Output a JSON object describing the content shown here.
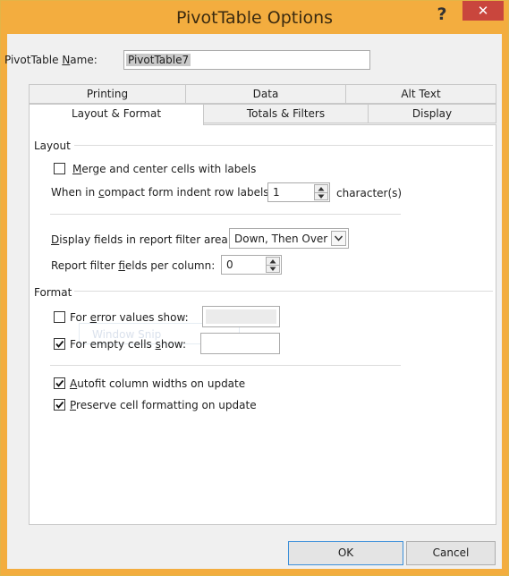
{
  "window": {
    "title": "PivotTable Options",
    "help_glyph": "?",
    "close_glyph": "✕"
  },
  "name_field": {
    "label_pre": "PivotTable ",
    "label_mnemonic": "N",
    "label_post": "ame:",
    "value": "PivotTable7"
  },
  "tabs": {
    "back_row": [
      "Printing",
      "Data",
      "Alt Text"
    ],
    "front_row": [
      "Layout & Format",
      "Totals & Filters",
      "Display"
    ],
    "active": "Layout & Format"
  },
  "layout_section": {
    "heading": "Layout",
    "merge_center": {
      "mnemonic": "M",
      "label_rest": "erge and center cells with labels",
      "checked": false
    },
    "indent": {
      "label_pre": "When in ",
      "mnemonic": "c",
      "label_post": "ompact form indent row labels:",
      "value": "1",
      "suffix": "character(s)"
    },
    "filter_area": {
      "mnemonic": "D",
      "label_rest": "isplay fields in report filter area:",
      "value": "Down, Then Over"
    },
    "filter_per_column": {
      "label_pre": "Report filter ",
      "mnemonic": "f",
      "label_post": "ields per column:",
      "value": "0"
    }
  },
  "format_section": {
    "heading": "Format",
    "error_values": {
      "label_pre": "For ",
      "mnemonic": "e",
      "label_post": "rror values show:",
      "checked": false,
      "value": ""
    },
    "empty_cells": {
      "label_pre": "For empty cells ",
      "mnemonic": "s",
      "label_post": "how:",
      "checked": true,
      "value": ""
    },
    "autofit": {
      "mnemonic": "A",
      "label_rest": "utofit column widths on update",
      "checked": true
    },
    "preserve": {
      "mnemonic": "P",
      "label_rest": "reserve cell formatting on update",
      "checked": true
    },
    "ghost_text": "Window Snip"
  },
  "buttons": {
    "ok": "OK",
    "cancel": "Cancel"
  },
  "colors": {
    "title_bar": "#f3ad3f",
    "close_button": "#c9463d",
    "default_button_border": "#3c8fd9"
  }
}
